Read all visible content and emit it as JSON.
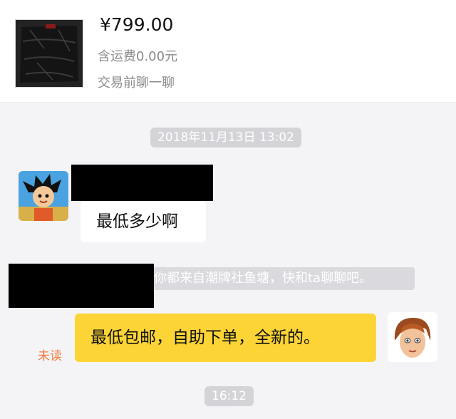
{
  "product": {
    "price": "¥799.00",
    "shipping": "含运费0.00元",
    "chat_prompt": "交易前聊一聊"
  },
  "chat": {
    "timestamps": [
      "2018年11月13日 13:02",
      "16:12"
    ],
    "messages": [
      {
        "from": "buyer",
        "text": "最低多少啊"
      },
      {
        "from": "seller",
        "text": "最低包邮，自助下单，全新的。",
        "status": "未读"
      }
    ],
    "system_notice": "⁣你都来自潮牌社鱼塘，快和ta聊聊吧。"
  },
  "colors": {
    "outgoing_bubble": "#fcd436",
    "unread_text": "#f07a3c",
    "pill_bg": "#d4d4d8"
  }
}
